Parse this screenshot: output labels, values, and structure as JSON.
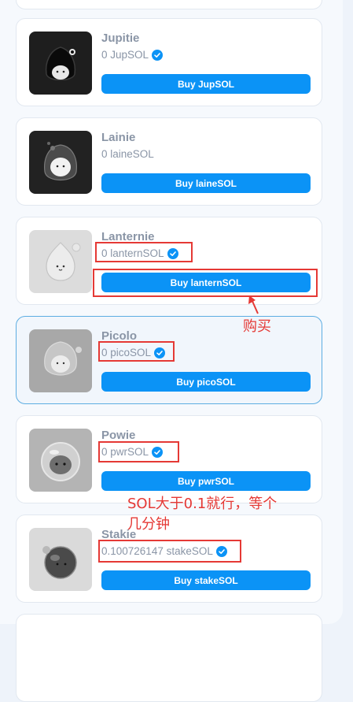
{
  "cards": [
    {
      "name": "Jupitie",
      "balance": "0 JupSOL",
      "button": "Buy JupSOL",
      "verified": true,
      "avatar_icon": "black-blob-icon"
    },
    {
      "name": "Lainie",
      "balance": "0 laineSOL",
      "button": "Buy laineSOL",
      "verified": false,
      "avatar_icon": "dark-ghost-icon"
    },
    {
      "name": "Lanternie",
      "balance": "0 lanternSOL",
      "button": "Buy lanternSOL",
      "verified": true,
      "avatar_icon": "lantern-blob-icon"
    },
    {
      "name": "Picolo",
      "balance": "0 picoSOL",
      "button": "Buy picoSOL",
      "verified": true,
      "avatar_icon": "pico-blob-icon"
    },
    {
      "name": "Powie",
      "balance": "0 pwrSOL",
      "button": "Buy pwrSOL",
      "verified": true,
      "avatar_icon": "helmet-blob-icon"
    },
    {
      "name": "Stakie",
      "balance": "0.100726147 stakeSOL",
      "button": "Buy stakeSOL",
      "verified": true,
      "avatar_icon": "planet-blob-icon"
    }
  ],
  "annotations": {
    "buy_note": "购买",
    "sol_note_line1": "SOL大于0.1就行，等个",
    "sol_note_line2": "几分钟"
  },
  "colors": {
    "button": "#0b93f6",
    "annotation": "#e53935",
    "active_border": "#5dade2"
  }
}
